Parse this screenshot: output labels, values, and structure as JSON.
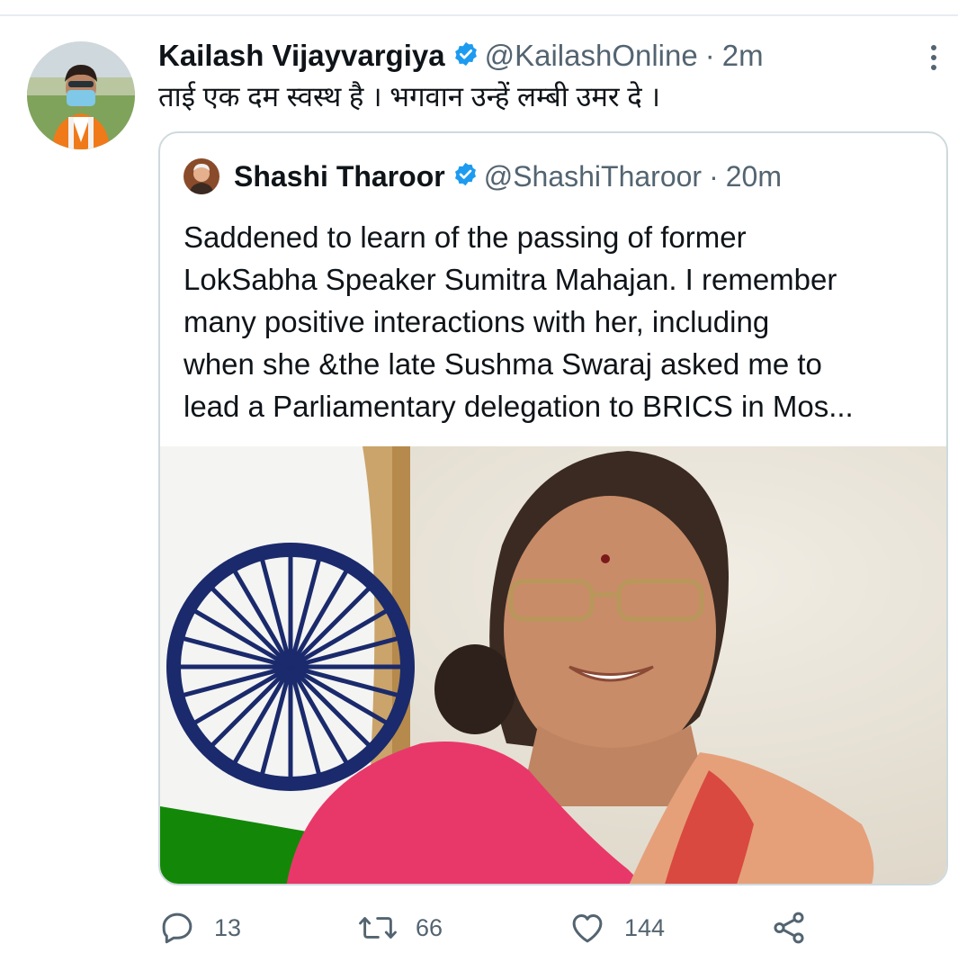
{
  "tweet": {
    "author_name": "Kailash Vijayvargiya",
    "author_handle": "@KailashOnline",
    "separator": "·",
    "time": "2m",
    "text": "ताई एक दम स्वस्थ है । भगवान उन्हें लम्बी उमर दे ।",
    "icons": {
      "more": "more-vertical-icon",
      "verified": "verified-badge-icon"
    }
  },
  "quoted": {
    "author_name": "Shashi Tharoor",
    "author_handle": "@ShashiTharoor",
    "separator": "·",
    "time": "20m",
    "text_lines": [
      "Saddened to learn of the passing of former",
      "LokSabha Speaker Sumitra Mahajan. I remember",
      "many positive interactions with her, including",
      "when she &the late Sushma Swaraj asked me to",
      "lead a Parliamentary delegation to BRICS in Mos..."
    ]
  },
  "actions": {
    "reply": {
      "icon": "reply-icon",
      "count": "13"
    },
    "retweet": {
      "icon": "retweet-icon",
      "count": "66"
    },
    "like": {
      "icon": "heart-icon",
      "count": "144"
    },
    "share": {
      "icon": "share-icon"
    }
  },
  "colors": {
    "verified": "#1d9bf0",
    "secondary_text": "#536471",
    "border": "#cfd9de",
    "saffron": "#f28c28",
    "green": "#138808",
    "chakra_navy": "#1a2a6c",
    "saree_pink": "#e8386a"
  }
}
